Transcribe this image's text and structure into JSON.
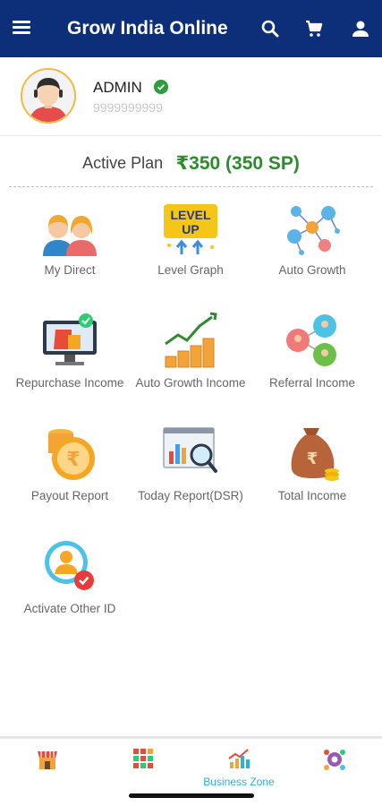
{
  "appbar": {
    "title": "Grow India Online",
    "icons": [
      "menu-icon",
      "search-icon",
      "cart-icon",
      "account-icon"
    ],
    "color": "#0d2f7a"
  },
  "profile": {
    "name": "ADMIN",
    "phone": "9999999999",
    "verified_color": "#2e9d3d"
  },
  "plan": {
    "label": "Active Plan",
    "value": "₹350 (350 SP)"
  },
  "tiles": [
    {
      "label": "My Direct"
    },
    {
      "label": "Level Graph"
    },
    {
      "label": "Auto Growth"
    },
    {
      "label": "Repurchase Income"
    },
    {
      "label": "Auto Growth Income"
    },
    {
      "label": "Referral Income"
    },
    {
      "label": "Payout Report"
    },
    {
      "label": "Today Report(DSR)"
    },
    {
      "label": "Total Income"
    },
    {
      "label": "Activate Other ID"
    }
  ],
  "bottom_nav": {
    "items": [
      {
        "icon": "shop-icon",
        "label": ""
      },
      {
        "icon": "grid-icon",
        "label": ""
      },
      {
        "icon": "business-chart-icon",
        "label": "Business Zone",
        "active": true
      },
      {
        "icon": "network-settings-icon",
        "label": ""
      }
    ],
    "active_color": "#2cb1d6"
  }
}
